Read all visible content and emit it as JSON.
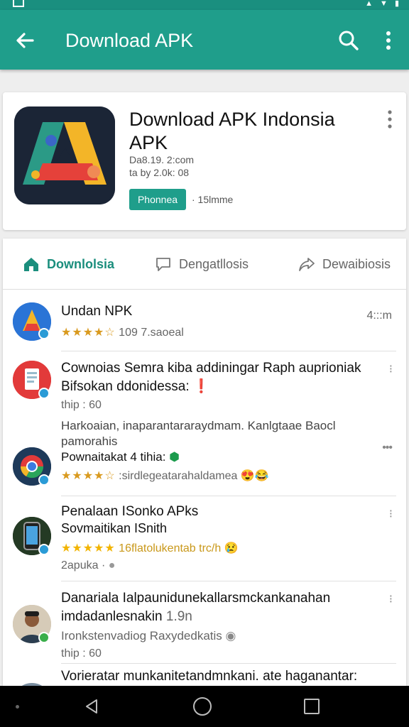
{
  "appbar": {
    "title": "Download APK",
    "icons": [
      "arrow-back-icon",
      "search-icon",
      "more-vert-icon"
    ],
    "color": "#1f9e8b"
  },
  "app": {
    "title": "Download APK Indonsia APK",
    "meta1": "Da8.19. 2:com",
    "meta2": "ta by 2.0k: 08",
    "install_label": "Phonnea",
    "install_note": "· 15lmme",
    "icon": "app-logo-a"
  },
  "tabs": [
    {
      "label": "Downlolsia",
      "icon": "home-icon",
      "active": true
    },
    {
      "label": "Dengatllosis",
      "icon": "chat-bubble-icon",
      "active": false
    },
    {
      "label": "Dewaibiosis",
      "icon": "share-icon",
      "active": false
    }
  ],
  "items": [
    {
      "title": "Undan NPK",
      "stars": "★★★★☆",
      "sub": "109 7.saoeal",
      "time": "4:::m"
    },
    {
      "title": "Cownoias Semra kiba addiningar Raph auprioniak",
      "title2": "Bifsokan ddonidessa:",
      "title2_mark": "❗",
      "sub": "thip : 60",
      "desc": "Harkoaian, inaparantararaydmam. Kanlgtaae Baocl",
      "desc2": "pamorahis",
      "more": "•••"
    },
    {
      "title": "Pownaitakat 4 tihia:",
      "stars": "★★★★☆",
      "sub": ":sirdlegeatarahaldamea",
      "emoji": "😍😂"
    },
    {
      "title": "Penalaan ISonko APks",
      "title2": "Sovmaitikan ISnith",
      "stars": "★★★★★",
      "sub": "16flatolukentab trc/h",
      "emoji": "😢",
      "sub2": "2apuka ·"
    },
    {
      "title": "Danariala Ialpaunidunekallarsmckankanahan",
      "title2": "imdadanlesnakin",
      "title2_extra": "1.9n",
      "sub": "Ironkstenvadiog Raxydedkatis",
      "sub2": "thip : 60"
    },
    {
      "title": "Vorieratar munkanitetandmnkani. ate haganantar:"
    }
  ],
  "colors": {
    "accent": "#1f9e8b",
    "statusbar": "#1a8f7f",
    "star": "#d99a1f",
    "star_gold": "#f2b400",
    "green_text": "#1b9b4c"
  }
}
